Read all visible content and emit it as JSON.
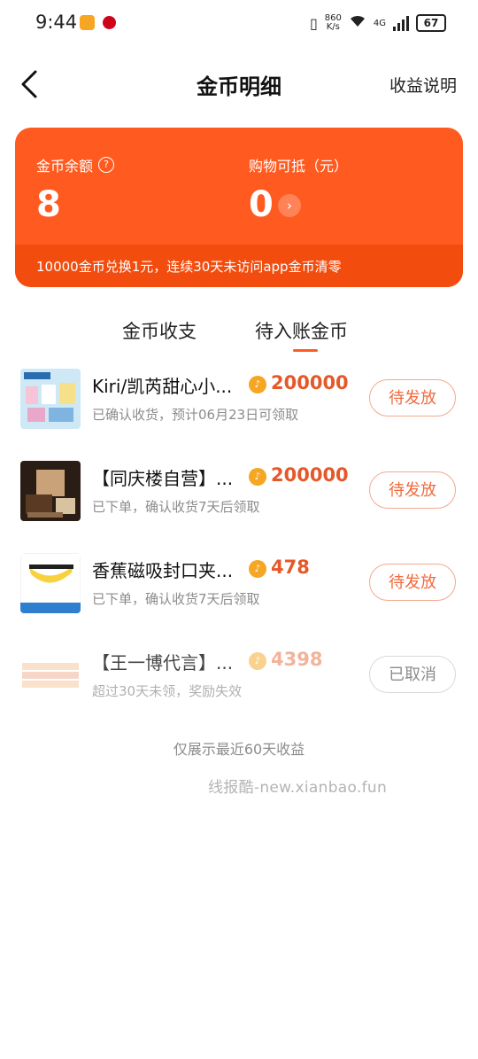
{
  "status_bar": {
    "time": "9:44",
    "speed": "860",
    "speed_unit": "K/s",
    "network": "4G",
    "battery": "67"
  },
  "nav": {
    "title": "金币明细",
    "right_link": "收益说明"
  },
  "card": {
    "balance_label": "金币余额",
    "balance_value": "8",
    "deduct_label": "购物可抵（元）",
    "deduct_value": "0",
    "footer_note": "10000金币兑换1元，连续30天未访问app金币清零",
    "bg_color": "#ff5a1f"
  },
  "tabs": [
    "金币收支",
    "待入账金币"
  ],
  "active_tab": 1,
  "items": [
    {
      "name": "Kiri/凯芮甜心小...",
      "coins": "200000",
      "sub": "已确认收货，预计06月23日可领取",
      "status": "待发放"
    },
    {
      "name": "【同庆楼自营】...",
      "coins": "200000",
      "sub": "已下单，确认收货7天后领取",
      "status": "待发放"
    },
    {
      "name": "香蕉磁吸封口夹...",
      "coins": "478",
      "sub": "已下单，确认收货7天后领取",
      "status": "待发放"
    },
    {
      "name": "【王一博代言】...",
      "coins": "4398",
      "sub": "超过30天未领，奖励失效",
      "status": "已取消"
    }
  ],
  "bottom_note": "仅展示最近60天收益",
  "watermark": "线报酷-new.xianbao.fun"
}
